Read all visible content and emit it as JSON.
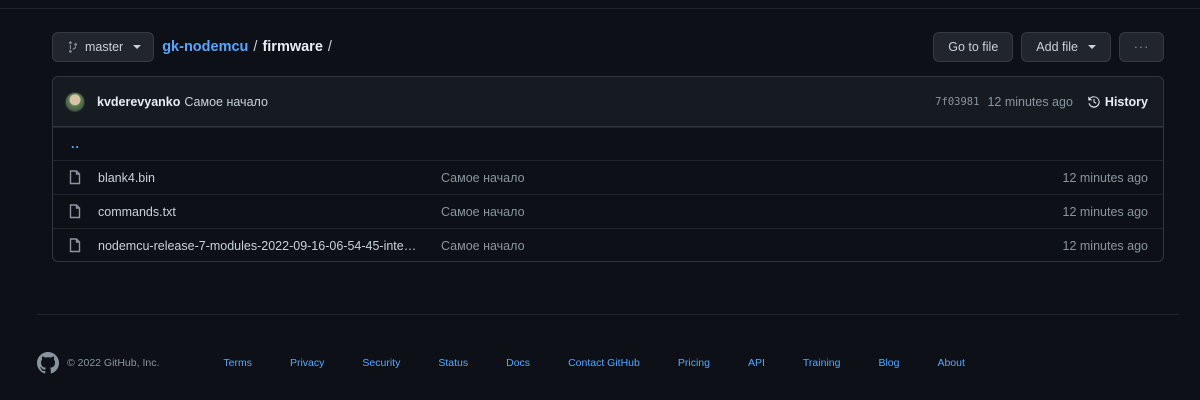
{
  "toolbar": {
    "branch": "master",
    "repo": "gk-nodemcu",
    "sep1": "/",
    "dir": "firmware",
    "sep2": "/",
    "go_to_file": "Go to file",
    "add_file": "Add file",
    "more": "···"
  },
  "commit": {
    "author": "kvderevyanko",
    "message": "Самое начало",
    "sha": "7f03981",
    "age": "12 minutes ago",
    "history": "History"
  },
  "parent_link": "..",
  "files": [
    {
      "name": "blank4.bin",
      "commit": "Самое начало",
      "age": "12 minutes ago"
    },
    {
      "name": "commands.txt",
      "commit": "Самое начало",
      "age": "12 minutes ago"
    },
    {
      "name": "nodemcu-release-7-modules-2022-09-16-06-54-45-inte…",
      "commit": "Самое начало",
      "age": "12 minutes ago"
    }
  ],
  "footer": {
    "copyright": "© 2022 GitHub, Inc.",
    "links": [
      "Terms",
      "Privacy",
      "Security",
      "Status",
      "Docs",
      "Contact GitHub",
      "Pricing",
      "API",
      "Training",
      "Blog",
      "About"
    ]
  },
  "colors": {
    "background": "#0d1117",
    "link": "#58a6ff",
    "muted": "#8b949e"
  }
}
